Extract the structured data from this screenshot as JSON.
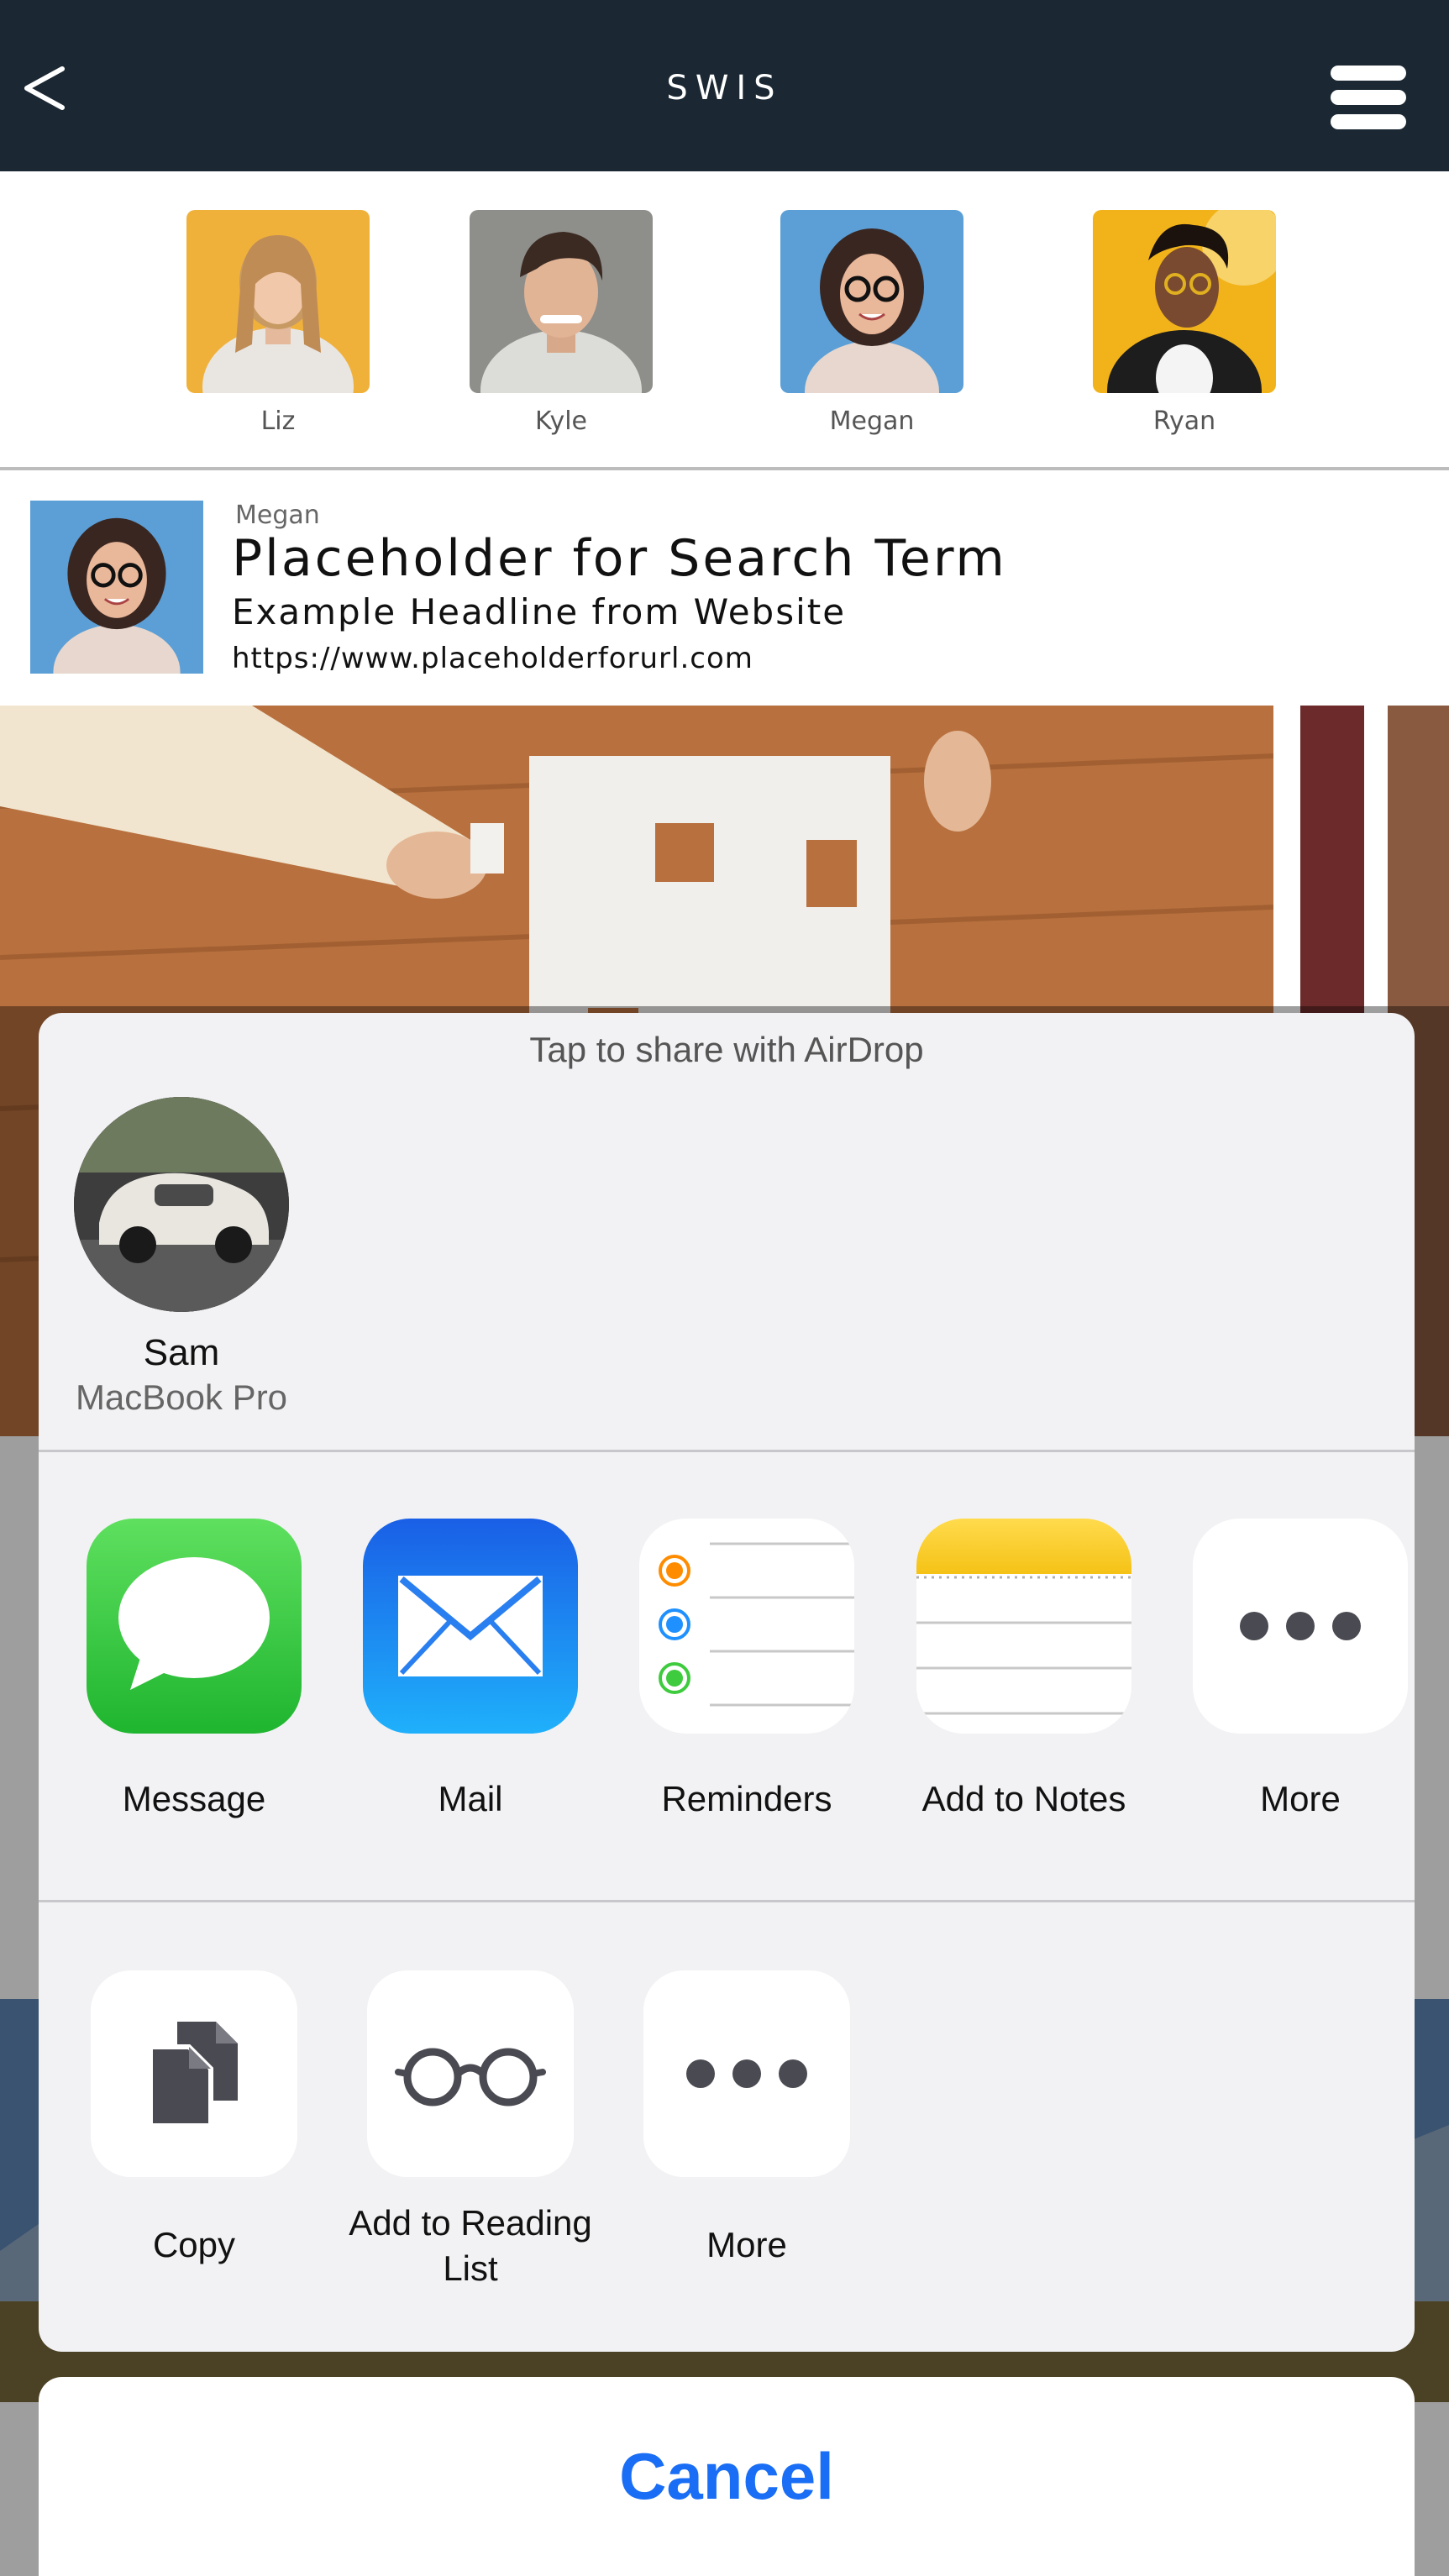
{
  "navbar": {
    "title": "SWIS"
  },
  "contacts": [
    {
      "name": "Liz"
    },
    {
      "name": "Kyle"
    },
    {
      "name": "Megan"
    },
    {
      "name": "Ryan"
    }
  ],
  "result": {
    "author": "Megan",
    "search_term": "Placeholder for Search Term",
    "headline": "Example Headline from Website",
    "url": "https://www.placeholderforurl.com"
  },
  "share_sheet": {
    "airdrop_title": "Tap to share with AirDrop",
    "device": {
      "name": "Sam",
      "model": "MacBook Pro"
    },
    "apps": [
      {
        "label": "Message",
        "icon": "message-icon"
      },
      {
        "label": "Mail",
        "icon": "mail-icon"
      },
      {
        "label": "Reminders",
        "icon": "reminders-icon"
      },
      {
        "label": "Add to Notes",
        "icon": "notes-icon"
      },
      {
        "label": "More",
        "icon": "more-icon"
      }
    ],
    "actions": [
      {
        "label": "Copy",
        "icon": "copy-icon"
      },
      {
        "label": "Add to Reading List",
        "icon": "glasses-icon"
      },
      {
        "label": "More",
        "icon": "more-icon"
      }
    ],
    "cancel_label": "Cancel"
  },
  "colors": {
    "navbar": "#1b2833",
    "sheet": "#f2f2f4",
    "accent_blue": "#1a6ef5",
    "message_green": "#3ecb3e",
    "mail_blue": "#1e90ff",
    "notes_yellow": "#ffd23a"
  }
}
